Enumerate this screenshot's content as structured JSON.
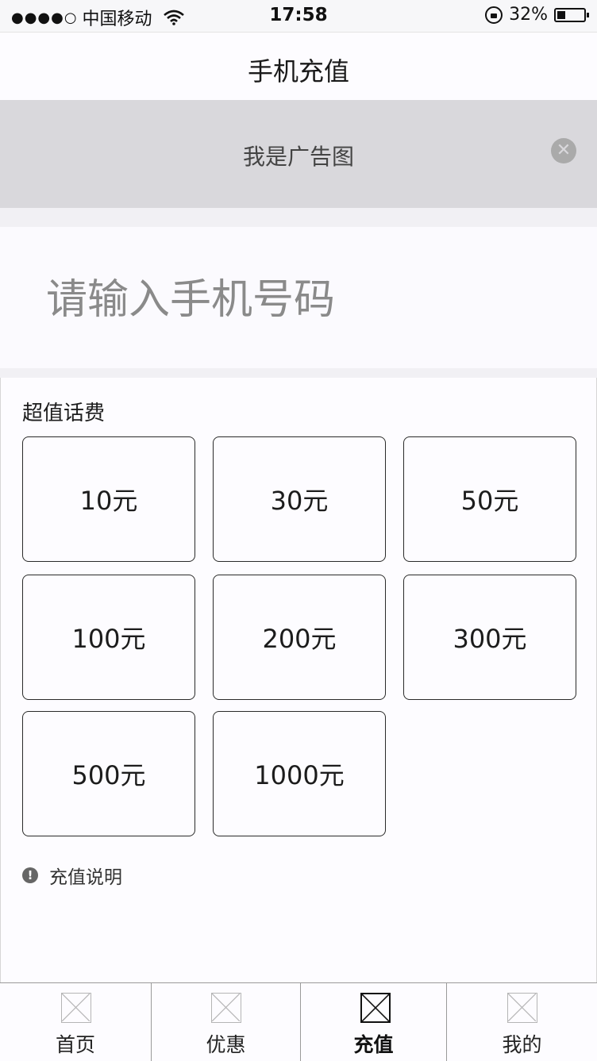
{
  "status_bar": {
    "signal": "●●●●○",
    "carrier": "中国移动",
    "time": "17:58",
    "battery_percent": "32%"
  },
  "nav": {
    "title": "手机充值"
  },
  "ad": {
    "text": "我是广告图",
    "close_icon": "close-icon"
  },
  "phone": {
    "placeholder": "请输入手机号码",
    "value": ""
  },
  "section": {
    "title": "超值话费"
  },
  "amounts": [
    "10元",
    "30元",
    "50元",
    "100元",
    "200元",
    "300元",
    "500元",
    "1000元"
  ],
  "notice": {
    "icon": "!",
    "text": "充值说明"
  },
  "tabs": [
    {
      "label": "首页",
      "icon": "placeholder-image-icon",
      "active": false
    },
    {
      "label": "优惠",
      "icon": "placeholder-image-icon",
      "active": false
    },
    {
      "label": "充值",
      "icon": "placeholder-image-icon",
      "active": true
    },
    {
      "label": "我的",
      "icon": "placeholder-image-icon",
      "active": false
    }
  ]
}
